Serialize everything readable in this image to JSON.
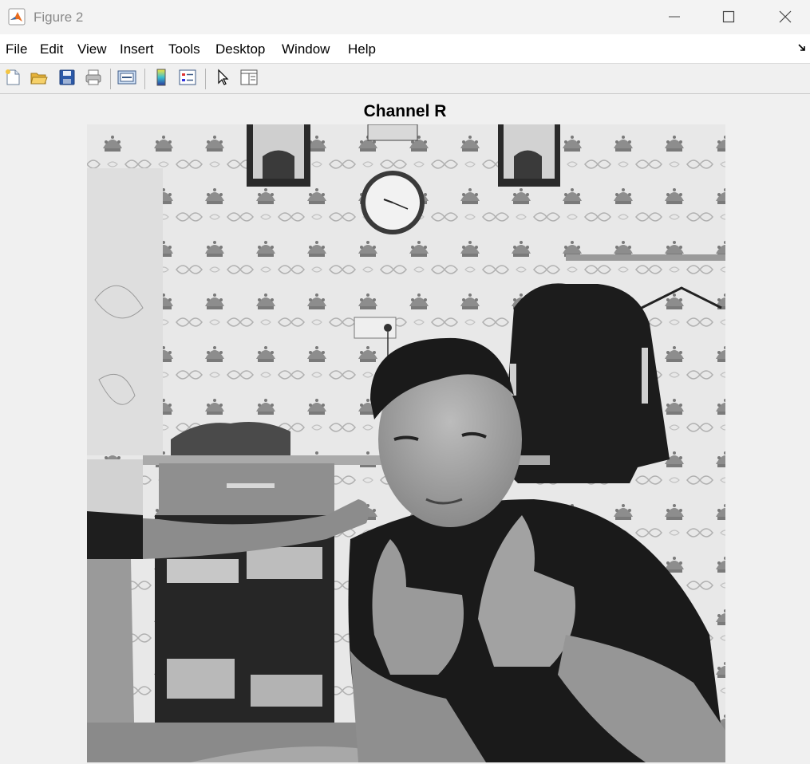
{
  "window": {
    "title": "Figure 2"
  },
  "menu": [
    "File",
    "Edit",
    "View",
    "Insert",
    "Tools",
    "Desktop",
    "Window",
    "Help"
  ],
  "toolbar": {
    "icons": [
      "new-figure-icon",
      "open-file-icon",
      "save-icon",
      "print-icon",
      "link-plot-icon",
      "insert-colorbar-icon",
      "insert-legend-icon",
      "pointer-icon",
      "property-inspector-icon"
    ]
  },
  "axes": {
    "title": "Channel R"
  },
  "image": {
    "description_color_mode": "grayscale"
  }
}
